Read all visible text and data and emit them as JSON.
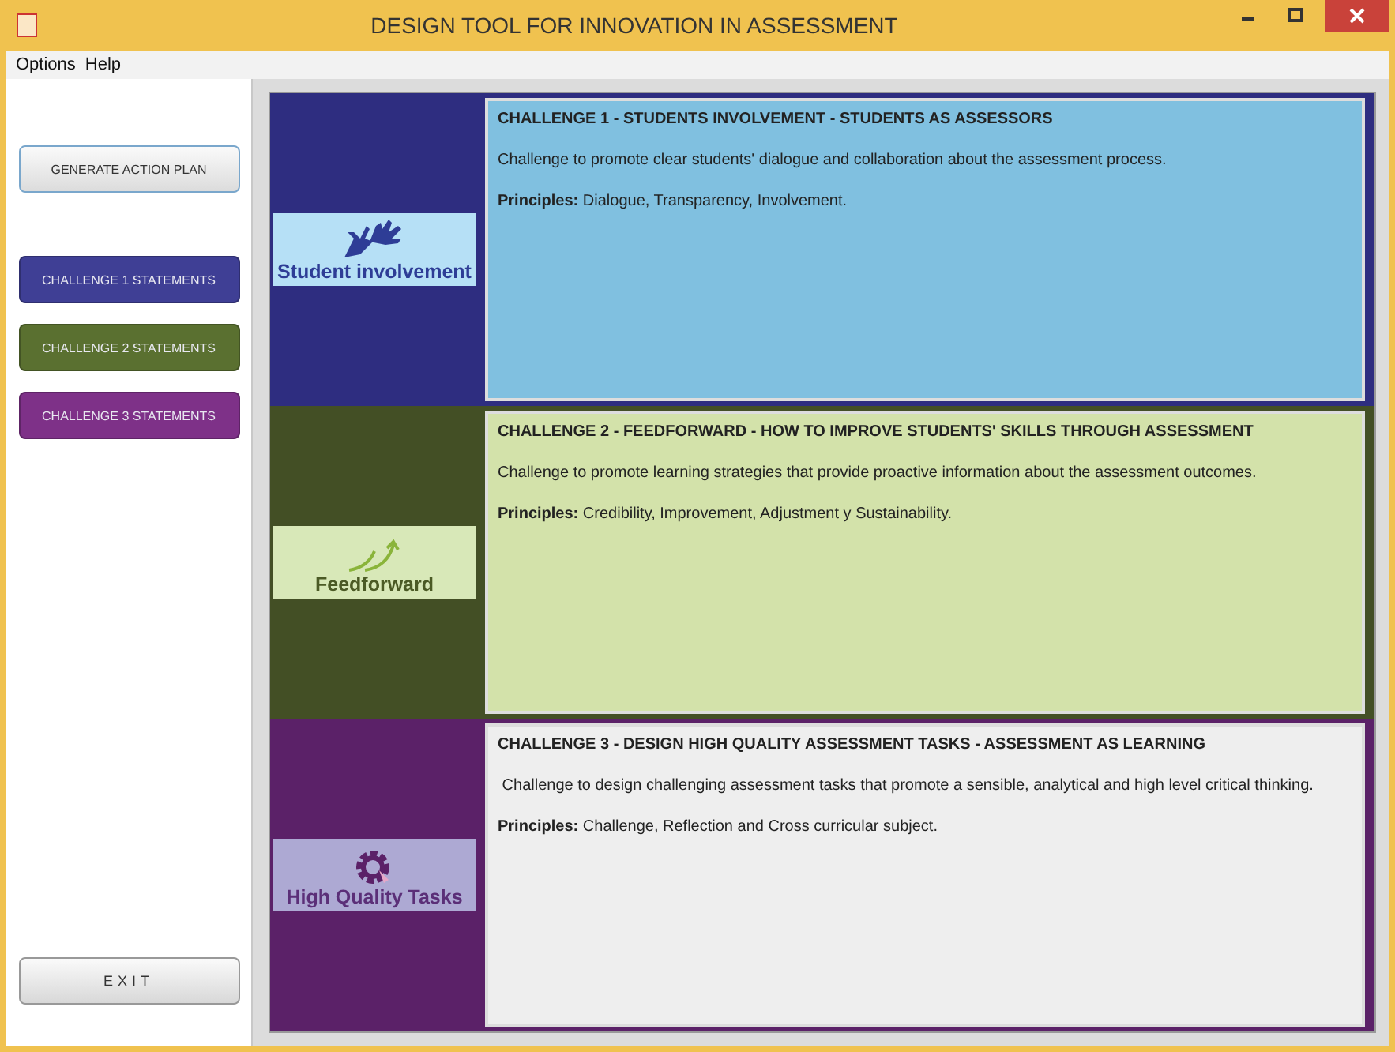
{
  "window": {
    "title": "DESIGN TOOL FOR INNOVATION IN ASSESSMENT"
  },
  "menu": [
    "Options",
    "Help"
  ],
  "sidebar": {
    "buttons": [
      {
        "label": "GENERATE ACTION PLAN",
        "kind": "plain"
      },
      {
        "label": "CHALLENGE 1 STATEMENTS",
        "kind": "colored",
        "color": "#3f3f95"
      },
      {
        "label": "CHALLENGE 2 STATEMENTS",
        "kind": "colored",
        "color": "#5a7030"
      },
      {
        "label": "CHALLENGE 3 STATEMENTS",
        "kind": "colored",
        "color": "#7e3188"
      }
    ],
    "exit": "EXIT"
  },
  "challenges": [
    {
      "logo": "Student involvement",
      "color": "#2e2d80",
      "title": "CHALLENGE 1 - STUDENTS INVOLVEMENT  -  STUDENTS AS ASSESSORS",
      "description": "Challenge to promote clear students' dialogue and collaboration about the assessment process.",
      "principles": "**Principles:** Dialogue, Transparency, Involvement."
    },
    {
      "logo": "Feedforward",
      "color": "#434f25",
      "title": "CHALLENGE 2 - FEEDFORWARD - HOW TO IMPROVE STUDENTS'  SKILLS THROUGH ASSESSMENT",
      "description": "Challenge to promote learning strategies that provide proactive information about the assessment outcomes.",
      "principles": "**Principles:** Credibility, Improvement, Adjustment y Sustainability."
    },
    {
      "logo": "High Quality Tasks",
      "color": "#5b2168",
      "title": "CHALLENGE 3 - DESIGN HIGH QUALITY ASSESSMENT TASKS  - ASSESSMENT AS LEARNING",
      "description": " Challenge to design challenging assessment tasks that promote a sensible, analytical and high level critical thinking.",
      "principles": "**Principles:** Challenge, Reflection and Cross curricular subject."
    }
  ]
}
